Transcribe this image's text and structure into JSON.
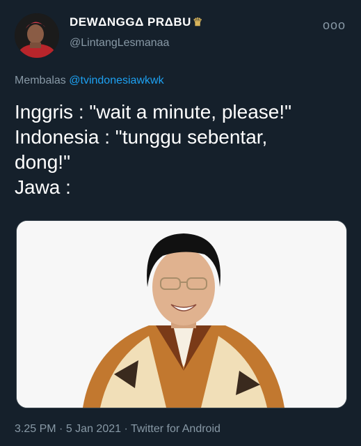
{
  "tweet": {
    "display_name": "DEWΔNGGΔ PRΔBU",
    "handle": "@LintangLesmanaa",
    "more_label": "ooo",
    "replying_prefix": "Membalas",
    "replying_to": "@tvindonesiawkwk",
    "lines": [
      "Inggris : \"wait a minute, please!\"",
      "Indonesia : \"tunggu sebentar,",
      "dong!\"",
      "Jawa :"
    ],
    "time": "3.25 PM",
    "sep1": "·",
    "date": "5 Jan 2021",
    "sep2": "·",
    "source": "Twitter for Android"
  },
  "colors": {
    "background": "#15202b",
    "secondary_text": "#8899a6",
    "link": "#1da1f2",
    "crown": "#d7b35a"
  },
  "icons": {
    "crown": "crown-icon",
    "more": "more-options-icon"
  }
}
